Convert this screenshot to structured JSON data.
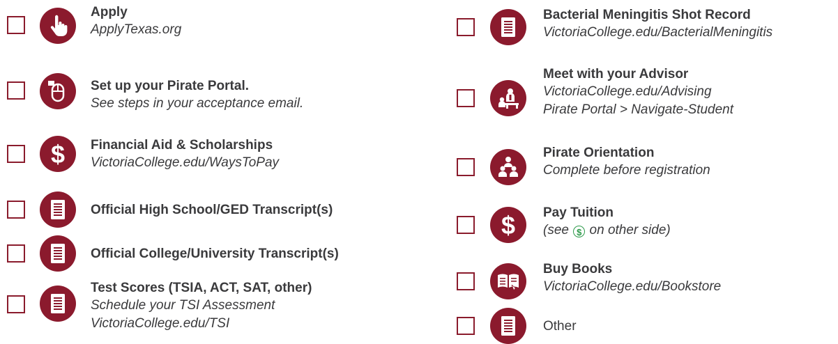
{
  "left": [
    {
      "icon": "hand-pointer-icon",
      "title": "Apply",
      "lines": [
        "ApplyTexas.org"
      ]
    },
    {
      "icon": "mouse-icon",
      "title": "Set up your Pirate Portal.",
      "lines": [
        "See steps in your acceptance email."
      ]
    },
    {
      "icon": "dollar-icon",
      "title": "Financial Aid & Scholarships",
      "lines": [
        "VictoriaCollege.edu/WaysToPay"
      ]
    },
    {
      "icon": "document-icon",
      "title": "Official High School/GED Transcript(s)",
      "lines": []
    },
    {
      "icon": "document-icon",
      "title": "Official College/University Transcript(s)",
      "lines": []
    },
    {
      "icon": "document-icon",
      "title": "Test Scores (TSIA, ACT, SAT, other)",
      "lines": [
        "Schedule your TSI Assessment",
        "VictoriaCollege.edu/TSI"
      ]
    }
  ],
  "right": [
    {
      "icon": "document-icon",
      "title": "Bacterial Meningitis Shot Record",
      "lines": [
        "VictoriaCollege.edu/BacterialMeningitis"
      ]
    },
    {
      "icon": "advisor-icon",
      "title": "Meet with your Advisor",
      "lines": [
        "VictoriaCollege.edu/Advising",
        "Pirate Portal > Navigate-Student"
      ]
    },
    {
      "icon": "group-icon",
      "title": "Pirate Orientation",
      "lines": [
        "Complete before registration"
      ]
    },
    {
      "icon": "dollar-icon",
      "title": "Pay Tuition",
      "note": {
        "before": "(see ",
        "symbol": "$",
        "after": " on other side)"
      }
    },
    {
      "icon": "book-icon",
      "title": "Buy Books",
      "lines": [
        "VictoriaCollege.edu/Bookstore"
      ]
    },
    {
      "icon": "document-icon",
      "other": "Other"
    }
  ],
  "colors": {
    "brand": "#8b1a2d",
    "text": "#3a3a3c",
    "money_note": "#2d9a4a"
  }
}
